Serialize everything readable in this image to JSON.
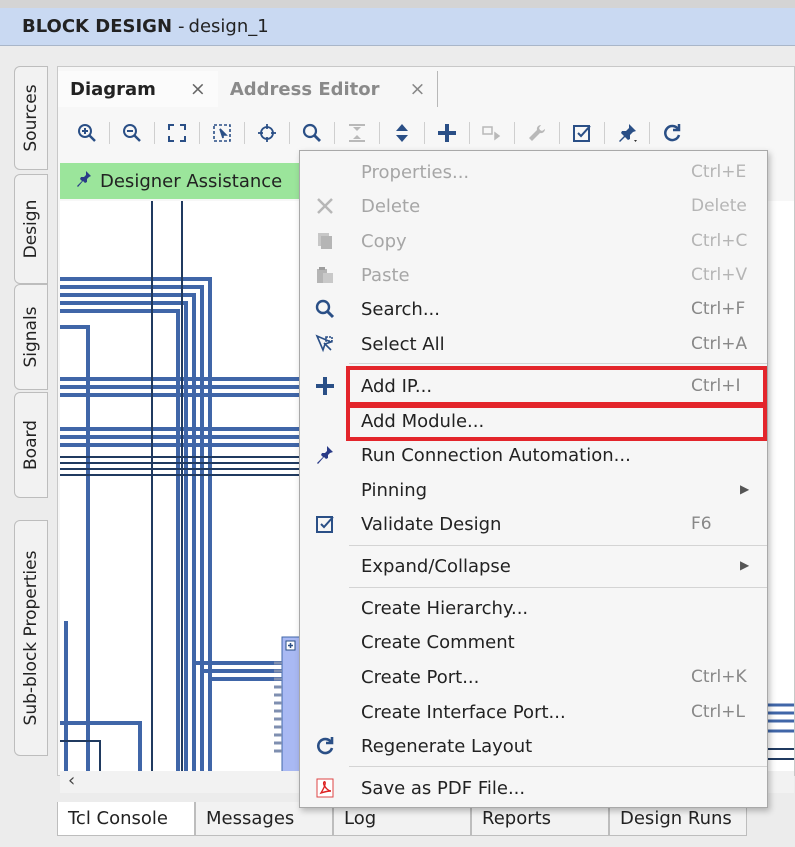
{
  "header": {
    "title": "BLOCK DESIGN",
    "subtitle": "design_1"
  },
  "side_tabs": [
    "Sources",
    "Design",
    "Signals",
    "Board",
    "Sub-block Properties"
  ],
  "tabs": [
    {
      "label": "Diagram",
      "close": "×"
    },
    {
      "label": "Address Editor",
      "close": "×"
    }
  ],
  "banner": {
    "label": "Designer Assistance"
  },
  "bottom_tabs": [
    "Tcl Console",
    "Messages",
    "Log",
    "Reports",
    "Design Runs"
  ],
  "context_menu": {
    "items": [
      {
        "label": "Properties...",
        "shortcut": "Ctrl+E",
        "icon": "none",
        "disabled": true
      },
      {
        "label": "Delete",
        "shortcut": "Delete",
        "icon": "delete-icon",
        "disabled": true
      },
      {
        "label": "Copy",
        "shortcut": "Ctrl+C",
        "icon": "copy-icon",
        "disabled": true
      },
      {
        "label": "Paste",
        "shortcut": "Ctrl+V",
        "icon": "paste-icon",
        "disabled": true
      },
      {
        "label": "Search...",
        "shortcut": "Ctrl+F",
        "icon": "search-icon",
        "disabled": false
      },
      {
        "label": "Select All",
        "shortcut": "Ctrl+A",
        "icon": "select-all-icon",
        "disabled": false
      },
      {
        "label": "Add IP...",
        "shortcut": "Ctrl+I",
        "icon": "plus-icon",
        "disabled": false
      },
      {
        "label": "Add Module...",
        "shortcut": "",
        "icon": "none",
        "disabled": false
      },
      {
        "label": "Run Connection Automation...",
        "shortcut": "",
        "icon": "pin-icon",
        "disabled": false
      },
      {
        "label": "Pinning",
        "shortcut": "",
        "icon": "none",
        "disabled": false,
        "submenu": true
      },
      {
        "label": "Validate Design",
        "shortcut": "F6",
        "icon": "validate-icon",
        "disabled": false
      },
      {
        "label": "Expand/Collapse",
        "shortcut": "",
        "icon": "none",
        "disabled": false,
        "submenu": true
      },
      {
        "label": "Create Hierarchy...",
        "shortcut": "",
        "icon": "none",
        "disabled": false
      },
      {
        "label": "Create Comment",
        "shortcut": "",
        "icon": "none",
        "disabled": false
      },
      {
        "label": "Create Port...",
        "shortcut": "Ctrl+K",
        "icon": "none",
        "disabled": false
      },
      {
        "label": "Create Interface Port...",
        "shortcut": "Ctrl+L",
        "icon": "none",
        "disabled": false
      },
      {
        "label": "Regenerate Layout",
        "shortcut": "",
        "icon": "refresh-icon",
        "disabled": false
      },
      {
        "label": "Save as PDF File...",
        "shortcut": "",
        "icon": "pdf-icon",
        "disabled": false
      }
    ]
  },
  "colors": {
    "accent": "#2a4f86",
    "highlight": "#e3252b",
    "banner": "#9be59b",
    "header": "#c9d9f2"
  }
}
